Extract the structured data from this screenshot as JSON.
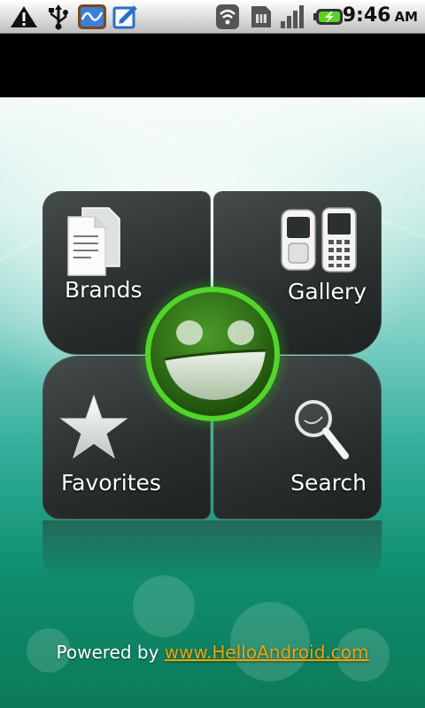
{
  "status_bar": {
    "time": "9:46",
    "ampm": "AM",
    "icons_left": [
      "warning-icon",
      "usb-icon",
      "app-notification-icon",
      "edit-notification-icon"
    ],
    "icons_right": [
      "wifi-icon",
      "sim-icon",
      "signal-icon",
      "battery-icon"
    ]
  },
  "menu": {
    "tiles": [
      {
        "label": "Brands",
        "icon": "documents-icon"
      },
      {
        "label": "Gallery",
        "icon": "phones-icon"
      },
      {
        "label": "Favorites",
        "icon": "star-icon"
      },
      {
        "label": "Search",
        "icon": "magnifier-icon"
      }
    ]
  },
  "footer": {
    "prefix": "Powered by ",
    "link_text": "www.HelloAndroid.com"
  },
  "colors": {
    "accent_green": "#3fc41f",
    "link": "#f2a500",
    "tile_bg": "#2f3434"
  }
}
